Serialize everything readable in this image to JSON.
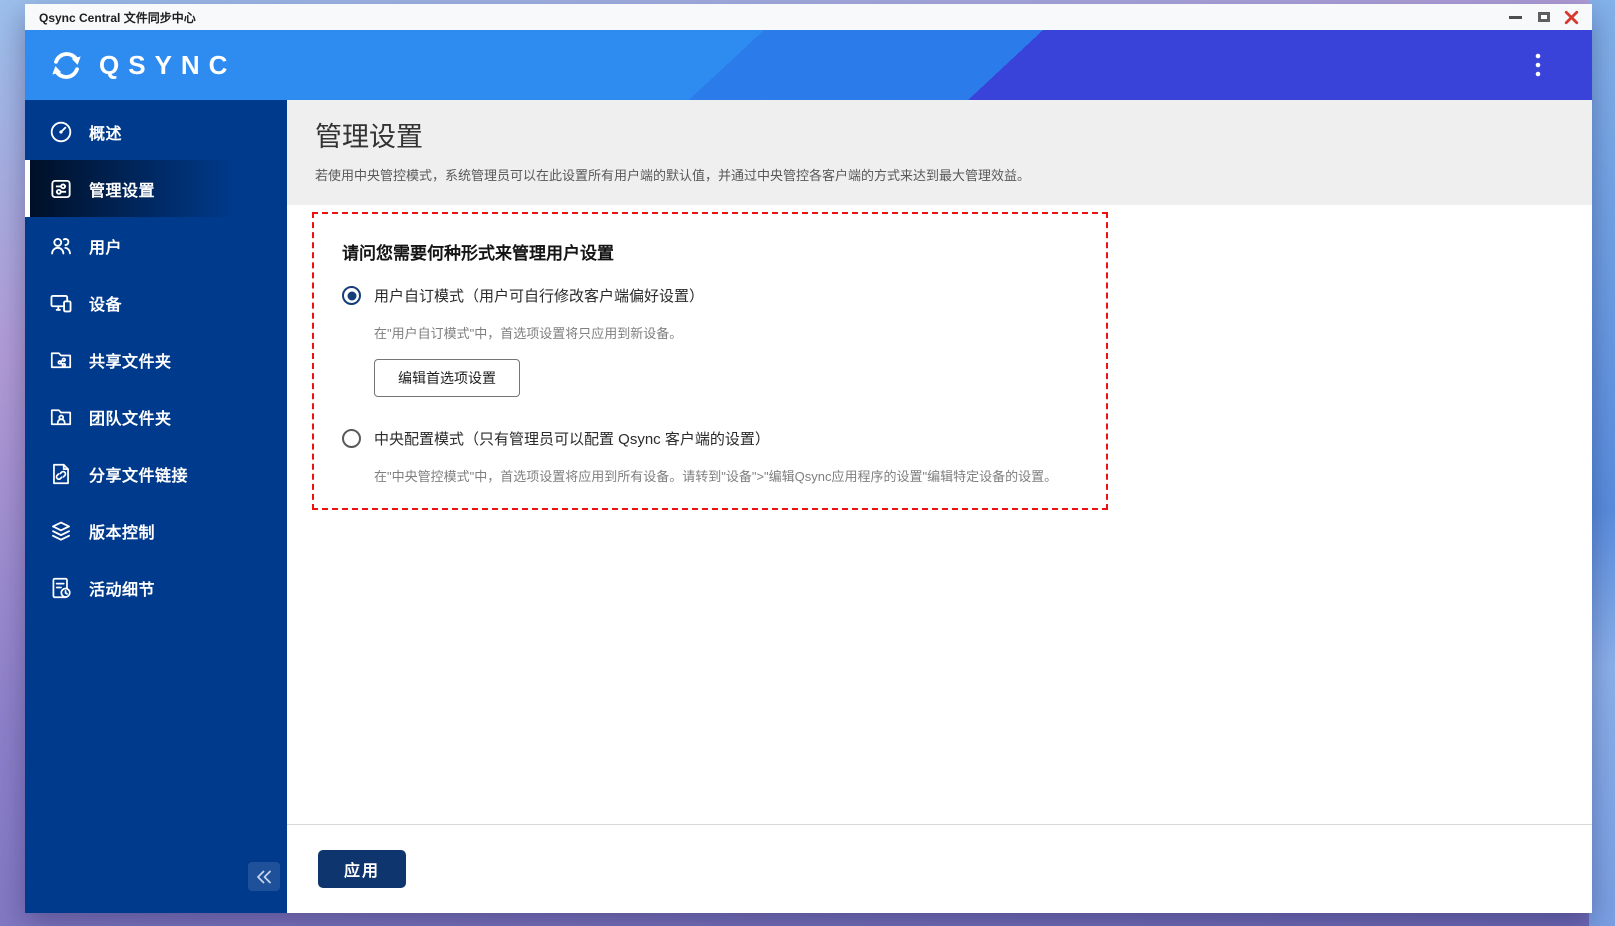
{
  "window": {
    "title": "Qsync Central 文件同步中心",
    "controls": [
      "minimize-icon",
      "maximize-icon",
      "close-icon"
    ]
  },
  "header": {
    "logo_text": "QSYNC",
    "logo_icon": "sync-arrows-icon",
    "menu_icon": "kebab-menu-icon"
  },
  "sidebar": {
    "items": [
      {
        "label": "概述",
        "icon": "gauge-icon",
        "selected": false
      },
      {
        "label": "管理设置",
        "icon": "sliders-icon",
        "selected": true
      },
      {
        "label": "用户",
        "icon": "users-icon",
        "selected": false
      },
      {
        "label": "设备",
        "icon": "devices-icon",
        "selected": false
      },
      {
        "label": "共享文件夹",
        "icon": "shared-folder-icon",
        "selected": false
      },
      {
        "label": "团队文件夹",
        "icon": "team-folder-icon",
        "selected": false
      },
      {
        "label": "分享文件链接",
        "icon": "share-link-icon",
        "selected": false
      },
      {
        "label": "版本控制",
        "icon": "versions-icon",
        "selected": false
      },
      {
        "label": "活动细节",
        "icon": "activity-icon",
        "selected": false
      }
    ],
    "collapse_icon": "double-chevron-left-icon"
  },
  "main": {
    "page_title": "管理设置",
    "page_description": "若使用中央管控模式，系统管理员可以在此设置所有用户端的默认值，并通过中央管控各客户端的方式来达到最大管理效益。",
    "question_heading": "请问您需要何种形式来管理用户设置",
    "options": [
      {
        "label": "用户自订模式（用户可自行修改客户端偏好设置）",
        "selected": true,
        "description": "在\"用户自订模式\"中，首选项设置将只应用到新设备。",
        "action_label": "编辑首选项设置"
      },
      {
        "label": "中央配置模式（只有管理员可以配置 Qsync 客户端的设置）",
        "selected": false,
        "description": "在\"中央管控模式\"中，首选项设置将应用到所有设备。请转到\"设备\">\"编辑Qsync应用程序的设置\"编辑特定设备的设置。"
      }
    ],
    "apply_label": "应用"
  },
  "colors": {
    "header_blue": "#2e8bf0",
    "header_indigo": "#3a43d9",
    "sidebar_blue": "#003a8c",
    "apply_navy": "#0e356e",
    "radio_navy": "#153d7a",
    "dashed_highlight_red": "#ee1111",
    "close_red": "#d63a2f",
    "page_head_gray": "#efefef"
  }
}
